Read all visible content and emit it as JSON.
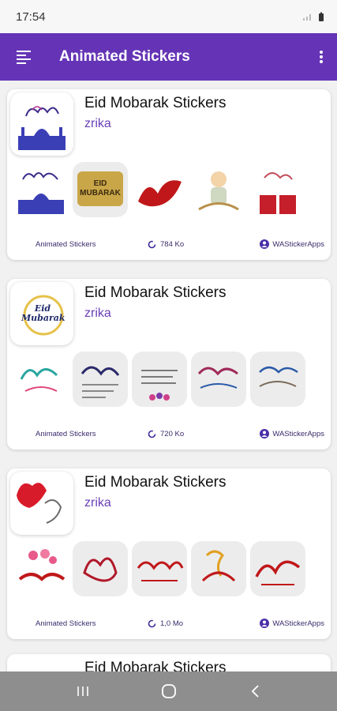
{
  "status": {
    "time": "17:54"
  },
  "toolbar": {
    "title": "Animated Stickers"
  },
  "colors": {
    "primary": "#6534b6",
    "author": "#6a3fb8"
  },
  "packs": [
    {
      "title": "Eid Mobarak Stickers",
      "author": "zrika",
      "category": "Animated Stickers",
      "size": "784 Ko",
      "publisher": "WAStickerApps"
    },
    {
      "title": "Eid Mobarak Stickers",
      "author": "zrika",
      "category": "Animated Stickers",
      "size": "720 Ko",
      "publisher": "WAStickerApps"
    },
    {
      "title": "Eid Mobarak Stickers",
      "author": "zrika",
      "category": "Animated Stickers",
      "size": "1,0 Mo",
      "publisher": "WAStickerApps"
    },
    {
      "title": "Eid Mobarak Stickers"
    }
  ],
  "sticker1_text": "EID MUBARAK",
  "icon2_text": "Eid Mubarak",
  "icons": {
    "menu": "menu-icon",
    "more": "more-vert-icon",
    "size": "loading-circle-icon",
    "publisher": "account-icon"
  }
}
